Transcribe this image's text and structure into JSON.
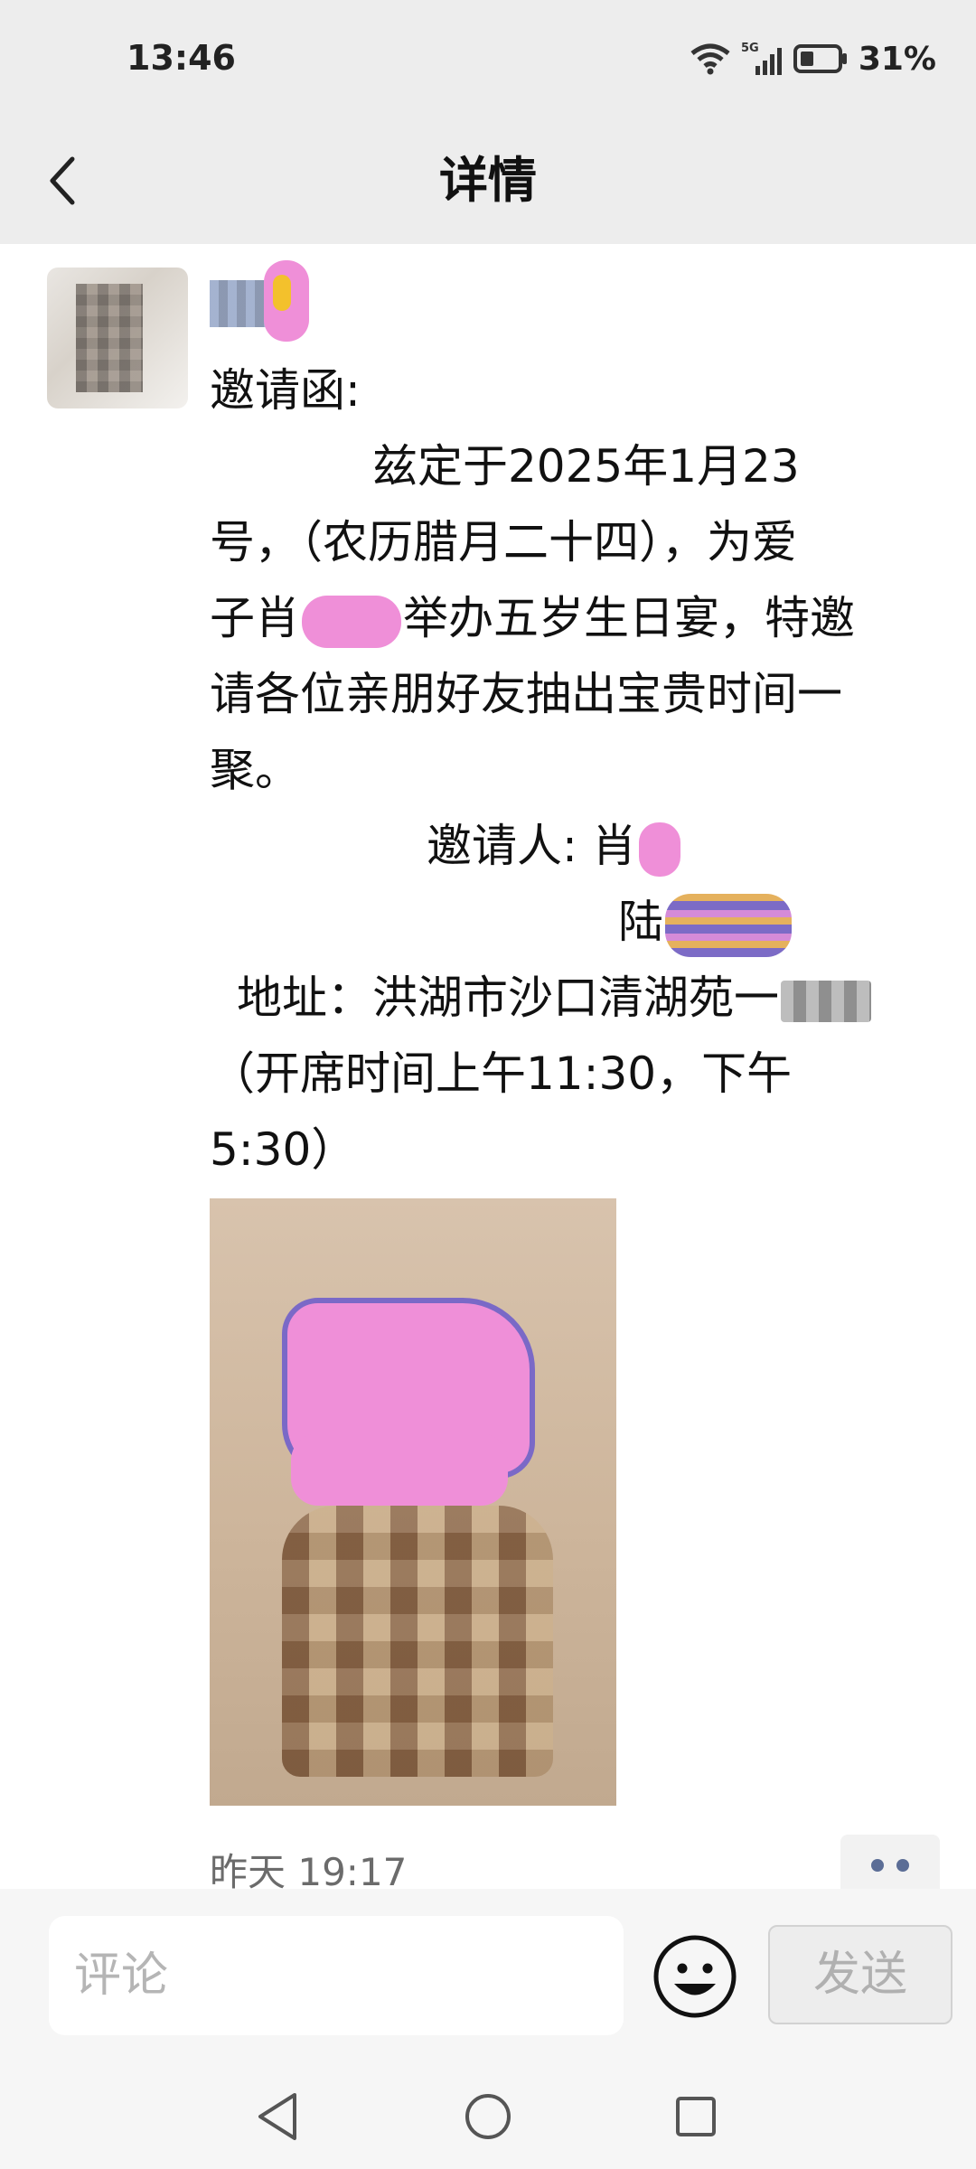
{
  "status_bar": {
    "time": "13:46",
    "network": "5G",
    "battery": "31%"
  },
  "nav": {
    "title": "详情"
  },
  "post": {
    "lines": [
      "邀请函:",
      "兹定于2025年1月23",
      "号，（农历腊月二十四），为爱",
      "子肖",
      "举办五岁生日宴，特邀",
      "请各位亲朋好友抽出宝贵时间一",
      "聚。",
      "邀请人: 肖",
      "陆",
      "地址：洪湖市沙口清湖苑一",
      "（开席时间上午11:30，下午",
      "5:30）"
    ],
    "time": "昨天 19:17"
  },
  "comment_bar": {
    "placeholder": "评论",
    "send_label": "发送"
  },
  "icons": {
    "back": "chevron-left-icon",
    "wifi": "wifi-icon",
    "signal": "signal-icon",
    "battery": "battery-icon",
    "emoji": "smiley-icon",
    "sys_back": "triangle-back-icon",
    "sys_home": "circle-home-icon",
    "sys_recent": "square-recent-icon"
  }
}
